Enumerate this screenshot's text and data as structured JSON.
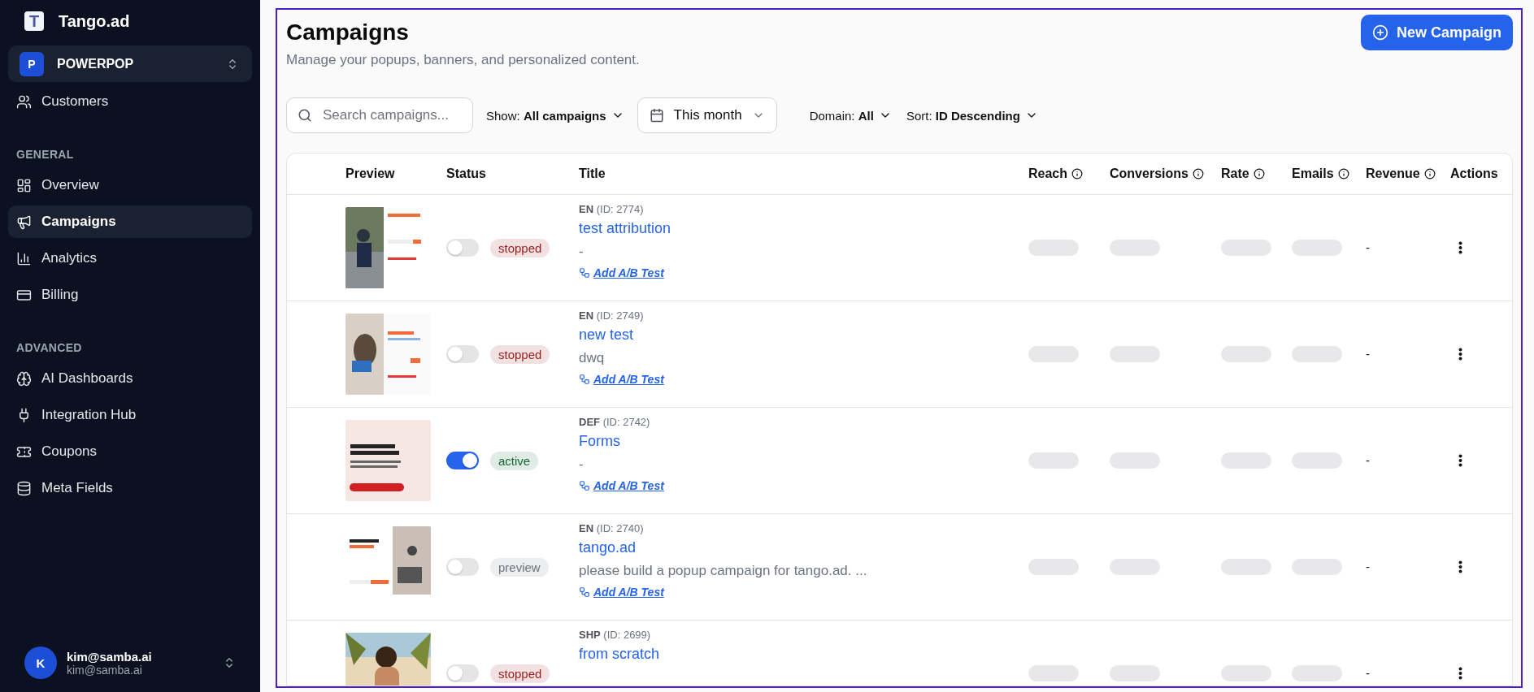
{
  "app": {
    "logo_letter": "T",
    "name": "Tango.ad"
  },
  "workspace": {
    "initial": "P",
    "name": "POWERPOP"
  },
  "top_items": [
    {
      "label": "Customers",
      "selected": false
    }
  ],
  "sections": [
    {
      "heading": "GENERAL",
      "items": [
        {
          "label": "Overview",
          "selected": false
        },
        {
          "label": "Campaigns",
          "selected": true
        },
        {
          "label": "Analytics",
          "selected": false
        },
        {
          "label": "Billing",
          "selected": false
        }
      ]
    },
    {
      "heading": "ADVANCED",
      "items": [
        {
          "label": "AI Dashboards",
          "selected": false
        },
        {
          "label": "Integration Hub",
          "selected": false
        },
        {
          "label": "Coupons",
          "selected": false
        },
        {
          "label": "Meta Fields",
          "selected": false
        }
      ]
    }
  ],
  "user": {
    "initial": "K",
    "name": "kim@samba.ai",
    "email": "kim@samba.ai"
  },
  "page": {
    "title": "Campaigns",
    "subtitle": "Manage your popups, banners, and personalized content.",
    "new_button": "New Campaign"
  },
  "filters": {
    "search": {
      "placeholder": "Search campaigns..."
    },
    "show": {
      "label": "Show:",
      "value": "All campaigns"
    },
    "date": {
      "value": "This month"
    },
    "domain": {
      "label": "Domain:",
      "value": "All"
    },
    "sort": {
      "label": "Sort:",
      "value": "ID Descending"
    }
  },
  "table": {
    "columns": [
      {
        "label": "Preview",
        "info": false
      },
      {
        "label": "Status",
        "info": false
      },
      {
        "label": "Title",
        "info": false
      },
      {
        "label": "Reach",
        "info": true
      },
      {
        "label": "Conversions",
        "info": true
      },
      {
        "label": "Rate",
        "info": true
      },
      {
        "label": "Emails",
        "info": true
      },
      {
        "label": "Revenue",
        "info": true
      },
      {
        "label": "Actions",
        "info": false
      }
    ],
    "rows": [
      {
        "on": false,
        "status": "stopped",
        "color": "#9b1c1c",
        "lang": "EN",
        "id": "(ID: 2774)",
        "title": "test attribution",
        "description": "-",
        "ab_link": "Add A/B Test",
        "loading": true,
        "revenue": "-"
      },
      {
        "on": false,
        "status": "stopped",
        "color": "#9b1c1c",
        "lang": "EN",
        "id": "(ID: 2749)",
        "title": "new test",
        "description": "dwq",
        "ab_link": "Add A/B Test",
        "loading": true,
        "revenue": "-"
      },
      {
        "on": true,
        "status": "active",
        "color": "#166534",
        "lang": "DEF",
        "id": "(ID: 2742)",
        "title": "Forms",
        "description": "-",
        "ab_link": "Add A/B Test",
        "loading": true,
        "revenue": "-"
      },
      {
        "on": false,
        "status": "preview",
        "color": "#6b7280",
        "lang": "EN",
        "id": "(ID: 2740)",
        "title": "tango.ad",
        "description": "please build a popup campaign for tango.ad. ...",
        "ab_link": "Add A/B Test",
        "loading": true,
        "revenue": "-"
      },
      {
        "on": false,
        "status": "stopped",
        "color": "#9b1c1c",
        "lang": "SHP",
        "id": "(ID: 2699)",
        "title": "from scratch",
        "loading": true,
        "revenue": "-"
      }
    ]
  }
}
